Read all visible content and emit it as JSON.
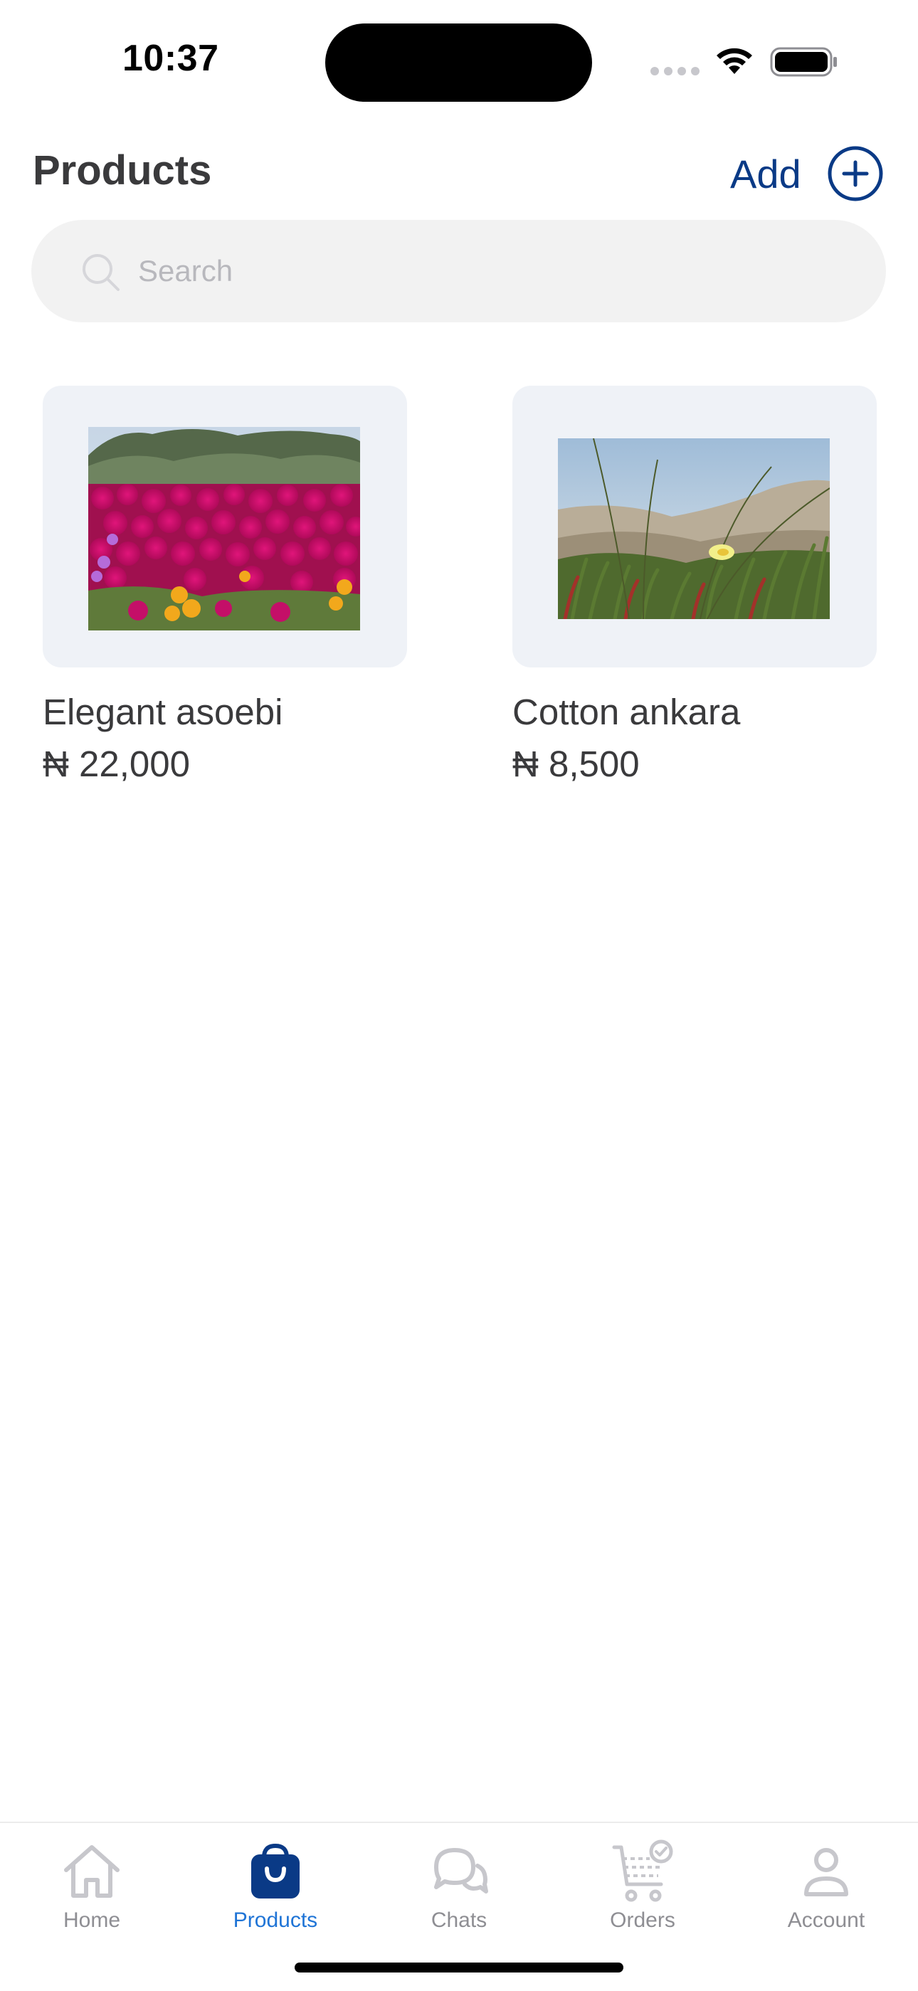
{
  "status_bar": {
    "time": "10:37"
  },
  "header": {
    "title": "Products",
    "add_label": "Add"
  },
  "search": {
    "placeholder": "Search",
    "value": ""
  },
  "products": [
    {
      "name": "Elegant asoebi",
      "price": "₦ 22,000",
      "image": "magenta-flower-field-photo"
    },
    {
      "name": "Cotton ankara",
      "price": "₦ 8,500",
      "image": "grass-dune-yellow-flower-photo"
    }
  ],
  "tabs": [
    {
      "label": "Home",
      "icon": "home-icon",
      "active": false
    },
    {
      "label": "Products",
      "icon": "shopping-bag-icon",
      "active": true
    },
    {
      "label": "Chats",
      "icon": "chat-bubbles-icon",
      "active": false
    },
    {
      "label": "Orders",
      "icon": "cart-check-icon",
      "active": false
    },
    {
      "label": "Account",
      "icon": "person-icon",
      "active": false
    }
  ],
  "colors": {
    "accent": "#0a3a86",
    "active_tab": "#1f74d6",
    "inactive_tab": "#8e8e93",
    "search_bg": "#f2f2f2",
    "card_bg": "#eff2f7"
  }
}
